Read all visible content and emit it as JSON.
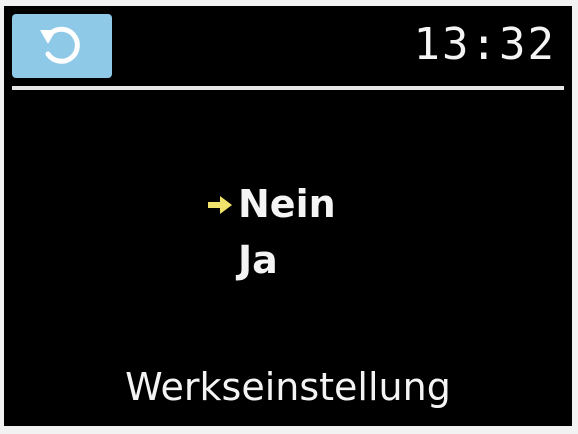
{
  "header": {
    "icon": "restore-icon",
    "time": "13:32"
  },
  "menu": {
    "items": [
      {
        "label": "Nein",
        "selected": true
      },
      {
        "label": "Ja",
        "selected": false
      }
    ]
  },
  "footer": {
    "title": "Werkseinstellung"
  },
  "colors": {
    "screen_background": "#000000",
    "icon_background": "#8ec9e8",
    "text": "#f4f4f4",
    "selection_arrow": "#f0e26a"
  }
}
